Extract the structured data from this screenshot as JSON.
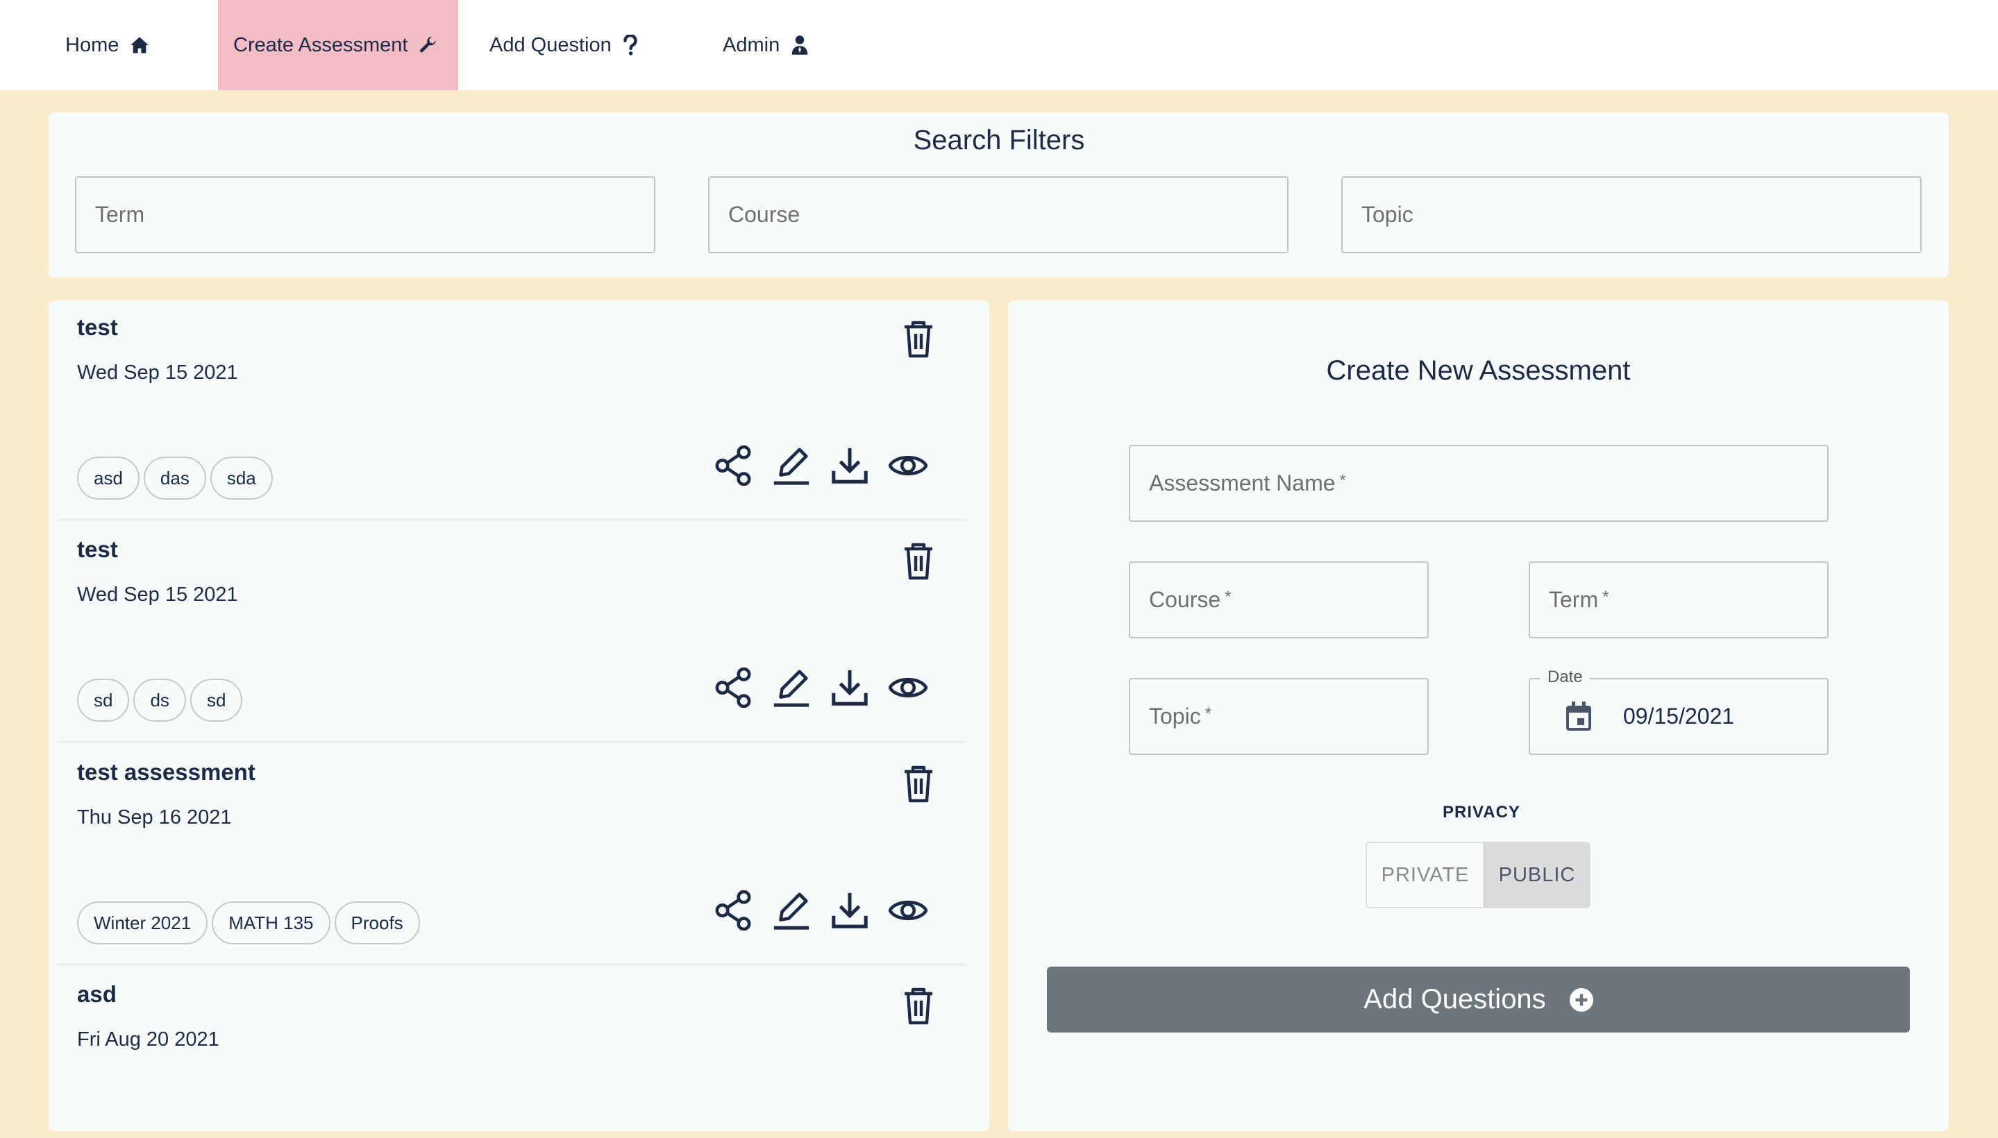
{
  "nav": {
    "home": "Home",
    "create": "Create Assessment",
    "add_question": "Add Question",
    "admin": "Admin",
    "active_color": "#f4bcc5"
  },
  "filters": {
    "title": "Search Filters",
    "term_placeholder": "Term",
    "course_placeholder": "Course",
    "topic_placeholder": "Topic"
  },
  "assessments": [
    {
      "title": "test",
      "date": "Wed Sep 15 2021",
      "tags": [
        "asd",
        "das",
        "sda"
      ]
    },
    {
      "title": "test",
      "date": "Wed Sep 15 2021",
      "tags": [
        "sd",
        "ds",
        "sd"
      ]
    },
    {
      "title": "test assessment",
      "date": "Thu Sep 16 2021",
      "tags": [
        "Winter 2021",
        "MATH 135",
        "Proofs"
      ]
    },
    {
      "title": "asd",
      "date": "Fri Aug 20 2021",
      "tags": []
    }
  ],
  "create": {
    "title": "Create New Assessment",
    "name_label": "Assessment Name",
    "course_label": "Course",
    "term_label": "Term",
    "topic_label": "Topic",
    "required_mark": "*",
    "date_label": "Date",
    "date_value": "09/15/2021",
    "privacy_label": "PRIVACY",
    "private_label": "PRIVATE",
    "public_label": "PUBLIC",
    "privacy_selected": "PUBLIC",
    "submit_label": "Add Questions"
  },
  "colors": {
    "background": "#faebcc",
    "panel": "#f7fbfb",
    "text": "#1c2a45",
    "button": "#6d757c"
  }
}
